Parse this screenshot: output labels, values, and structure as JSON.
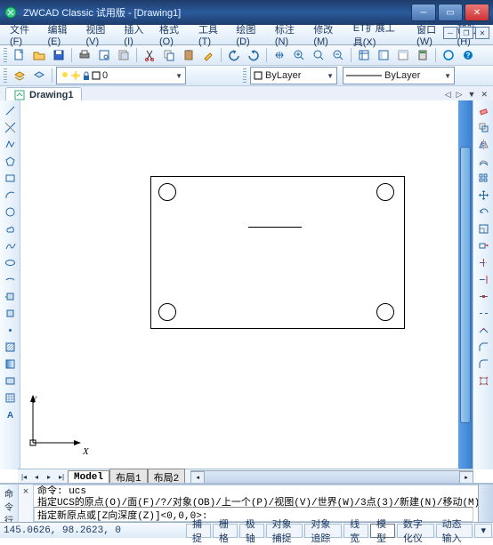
{
  "title": "ZWCAD Classic 试用版 - [Drawing1]",
  "menu": [
    "文件(F)",
    "编辑(E)",
    "视图(V)",
    "插入(I)",
    "格式(O)",
    "工具(T)",
    "绘图(D)",
    "标注(N)",
    "修改(M)",
    "ET扩展工具(X)",
    "窗口(W)",
    "帮助(H)"
  ],
  "layer_combo": "0",
  "bylayer1": "ByLayer",
  "bylayer2": "ByLayer",
  "doc_tab": "Drawing1",
  "ucs": {
    "x": "X",
    "y": "Y"
  },
  "layout_tabs": [
    "Model",
    "布局1",
    "布局2"
  ],
  "cmd_history": "命令: ucs\n指定UCS的原点(O)/面(F)/?/对象(OB)/上一个(P)/视图(V)/世界(W)/3点(3)/新建(N)/移动(M)/删除(D",
  "cmd_close_hint": "×",
  "cmd_prompt": "指定新原点或[Z向深度(Z)]<0,0,0>:",
  "status": {
    "coords": "145.0626,  98.2623,  0",
    "panes": [
      "捕捉",
      "栅格",
      "极轴",
      "对象捕捉",
      "对象追踪",
      "线宽",
      "模型",
      "数字化仪",
      "动态输入"
    ],
    "active_idx": 6
  },
  "side_tools": [
    "命",
    "令",
    "行"
  ]
}
